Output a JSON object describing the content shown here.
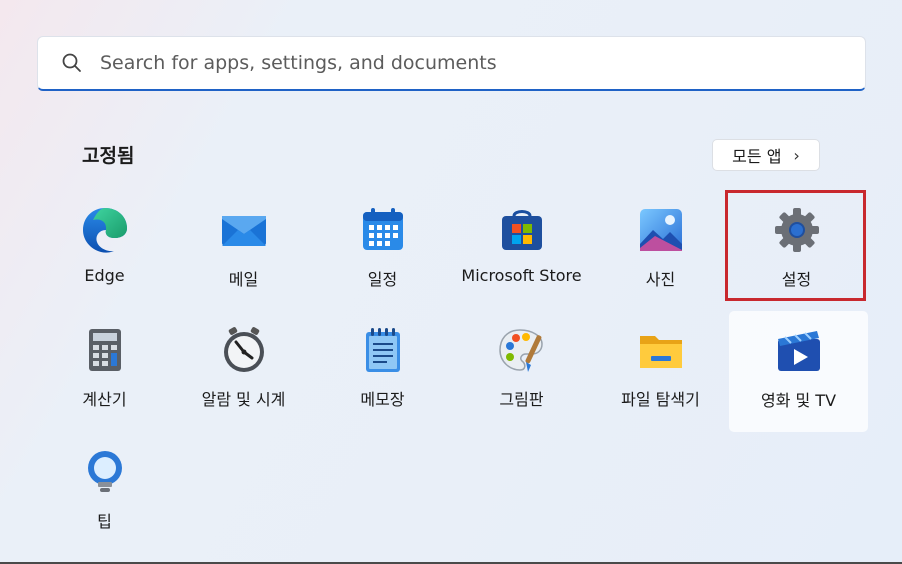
{
  "search": {
    "placeholder": "Search for apps, settings, and documents"
  },
  "pinned": {
    "title": "고정됨",
    "all_apps_label": "모든 앱"
  },
  "apps": [
    {
      "label": "Edge",
      "icon": "edge-icon"
    },
    {
      "label": "메일",
      "icon": "mail-icon"
    },
    {
      "label": "일정",
      "icon": "calendar-icon"
    },
    {
      "label": "Microsoft Store",
      "icon": "store-icon"
    },
    {
      "label": "사진",
      "icon": "photos-icon"
    },
    {
      "label": "설정",
      "icon": "gear-icon"
    },
    {
      "label": "계산기",
      "icon": "calculator-icon"
    },
    {
      "label": "알람 및 시계",
      "icon": "clock-icon"
    },
    {
      "label": "메모장",
      "icon": "notepad-icon"
    },
    {
      "label": "그림판",
      "icon": "paint-icon"
    },
    {
      "label": "파일 탐색기",
      "icon": "folder-icon"
    },
    {
      "label": "영화 및 TV",
      "icon": "movies-icon"
    },
    {
      "label": "팁",
      "icon": "tips-icon"
    }
  ],
  "colors": {
    "accent": "#1f62c6",
    "highlight": "#c8282e"
  }
}
